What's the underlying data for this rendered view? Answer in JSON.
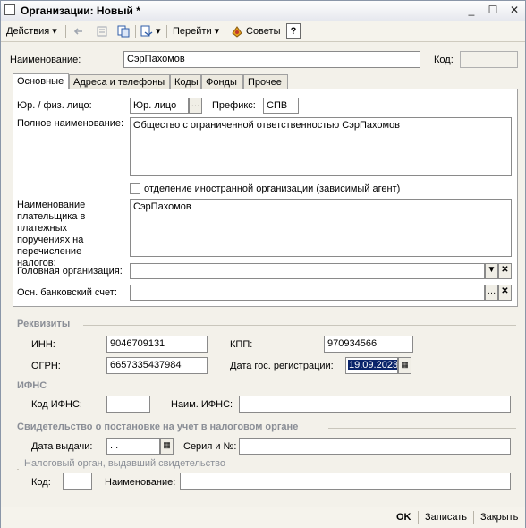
{
  "window": {
    "title": "Организации: Новый *",
    "minimize": "_",
    "maximize": "☐",
    "close": "✕"
  },
  "toolbar": {
    "actions": "Действия",
    "goto": "Перейти",
    "tips": "Советы",
    "help": "?"
  },
  "header": {
    "name_label": "Наименование:",
    "name_value": "СэрПахомов",
    "code_label": "Код:",
    "code_value": ""
  },
  "tabs": [
    "Основные",
    "Адреса и телефоны",
    "Коды",
    "Фонды",
    "Прочее"
  ],
  "main": {
    "legal_label": "Юр. / физ. лицо:",
    "legal_value": "Юр. лицо",
    "prefix_label": "Префикс:",
    "prefix_value": "СПВ",
    "fullname_label": "Полное наименование:",
    "fullname_value": "Общество с ограниченной ответственностью СэрПахомов",
    "foreign_label": "отделение иностранной организации (зависимый агент)",
    "payer_label": "Наименование плательщика в платежных поручениях на перечисление налогов:",
    "payer_value": "СэрПахомов",
    "head_org_label": "Головная организация:",
    "head_org_value": "",
    "bank_label": "Осн. банковский счет:",
    "bank_value": ""
  },
  "requisites": {
    "title": "Реквизиты",
    "inn_label": "ИНН:",
    "inn_value": "9046709131",
    "kpp_label": "КПП:",
    "kpp_value": "970934566",
    "ogrn_label": "ОГРН:",
    "ogrn_value": "6657335437984",
    "regdate_label": "Дата гос. регистрации:",
    "regdate_value": "19.09.2023"
  },
  "ifns": {
    "title": "ИФНС",
    "code_label": "Код ИФНС:",
    "code_value": "",
    "name_label": "Наим. ИФНС:",
    "name_value": ""
  },
  "certificate": {
    "title": "Свидетельство о постановке на учет в налоговом органе",
    "issue_label": "Дата выдачи:",
    "issue_value": " .  .",
    "series_label": "Серия и №:",
    "series_value": "",
    "authority_title": "Налоговый орган, выдавший свидетельство",
    "code_label": "Код:",
    "code_value": "",
    "name_label": "Наименование:",
    "name_value": ""
  },
  "footer": {
    "ok": "OK",
    "save": "Записать",
    "close": "Закрыть"
  }
}
